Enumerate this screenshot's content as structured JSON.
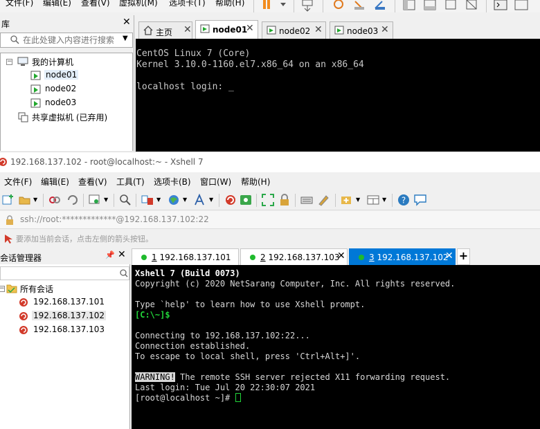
{
  "vmware": {
    "menu": [
      "文件(F)",
      "编辑(E)",
      "查看(V)",
      "虚拟机(M)",
      "选项卡(T)",
      "帮助(H)"
    ],
    "library": {
      "title": "库",
      "search_placeholder": "在此处键入内容进行搜索",
      "tree": {
        "root": "我的计算机",
        "vms": [
          "node01",
          "node02",
          "node03"
        ],
        "shared": "共享虚拟机 (已弃用)"
      }
    },
    "tabs": [
      {
        "label": "主页",
        "icon": "home-icon"
      },
      {
        "label": "node01",
        "icon": "vm-icon",
        "active": true
      },
      {
        "label": "node02",
        "icon": "vm-icon"
      },
      {
        "label": "node03",
        "icon": "vm-icon"
      }
    ],
    "console": {
      "lines": [
        "CentOS Linux 7 (Core)",
        "Kernel 3.10.0-1160.el7.x86_64 on an x86_64",
        "",
        "localhost login: _"
      ]
    }
  },
  "xshell": {
    "window_title": "192.168.137.102 - root@localhost:~ - Xshell 7",
    "menu": [
      "文件(F)",
      "编辑(E)",
      "查看(V)",
      "工具(T)",
      "选项卡(B)",
      "窗口(W)",
      "帮助(H)"
    ],
    "address": "ssh://root:*************@192.168.137.102:22",
    "hint": "要添加当前会话，点击左侧的箭头按钮。",
    "session_manager": {
      "title": "会话管理器",
      "pin": "ᚷ",
      "root": "所有会话",
      "sessions": [
        "192.168.137.101",
        "192.168.137.102",
        "192.168.137.103"
      ]
    },
    "tabs": [
      {
        "num": "1",
        "label": "192.168.137.101"
      },
      {
        "num": "2",
        "label": "192.168.137.103"
      },
      {
        "num": "3",
        "label": "192.168.137.102",
        "active": true
      }
    ],
    "terminal": {
      "banner": "Xshell 7 (Build 0073)",
      "copyright": "Copyright (c) 2020 NetSarang Computer, Inc. All rights reserved.",
      "help": "Type `help' to learn how to use Xshell prompt.",
      "local_prompt": "[C:\\~]$",
      "connecting": "Connecting to 192.168.137.102:22...",
      "established": "Connection established.",
      "escape": "To escape to local shell, press 'Ctrl+Alt+]'.",
      "warning_tag": "WARNING!",
      "warning_msg": " The remote SSH server rejected X11 forwarding request.",
      "last_login": "Last login: Tue Jul 20 22:30:07 2021",
      "remote_prompt": "[root@localhost ~]# "
    }
  },
  "colors": {
    "accent": "#0078d7",
    "green": "#1fba2d",
    "xshell_red": "#d23a2a"
  }
}
